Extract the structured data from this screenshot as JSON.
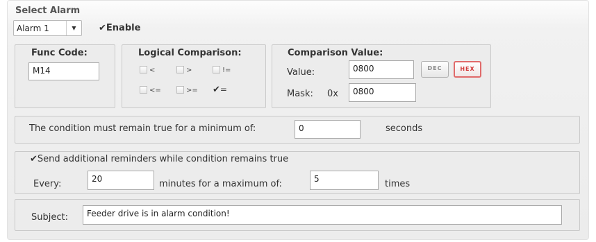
{
  "select_alarm": {
    "title": "Select Alarm",
    "selected": "Alarm 1",
    "enable_label": "Enable",
    "enable_checked": true
  },
  "func_code": {
    "legend": "Func Code:",
    "value": "M14"
  },
  "logical": {
    "legend": "Logical Comparison:",
    "options": [
      {
        "label": "<",
        "checked": false
      },
      {
        "label": ">",
        "checked": false
      },
      {
        "label": "!=",
        "checked": false
      },
      {
        "label": "<=",
        "checked": false
      },
      {
        "label": ">=",
        "checked": false
      },
      {
        "label": "=",
        "checked": true
      }
    ]
  },
  "comparison": {
    "legend": "Comparison Value:",
    "value_label": "Value:",
    "value": "0800",
    "dec_label": "DEC",
    "hex_label": "HEX",
    "mask_label": "Mask:",
    "mask_prefix": "0x",
    "mask_value": "0800"
  },
  "condition": {
    "prefix": "The condition must remain true for a minimum of:",
    "value": "0",
    "suffix": "seconds"
  },
  "reminders": {
    "label": "Send additional reminders while condition remains true",
    "checked": true,
    "every_label": "Every:",
    "every_value": "20",
    "minutes_label": "minutes for a maximum of:",
    "max_value": "5",
    "times_label": "times"
  },
  "subject": {
    "label": "Subject:",
    "value": "Feeder drive is in alarm condition!"
  },
  "colors": {
    "hex_active": "#d23a3a",
    "panel_bg": "#ececec"
  }
}
